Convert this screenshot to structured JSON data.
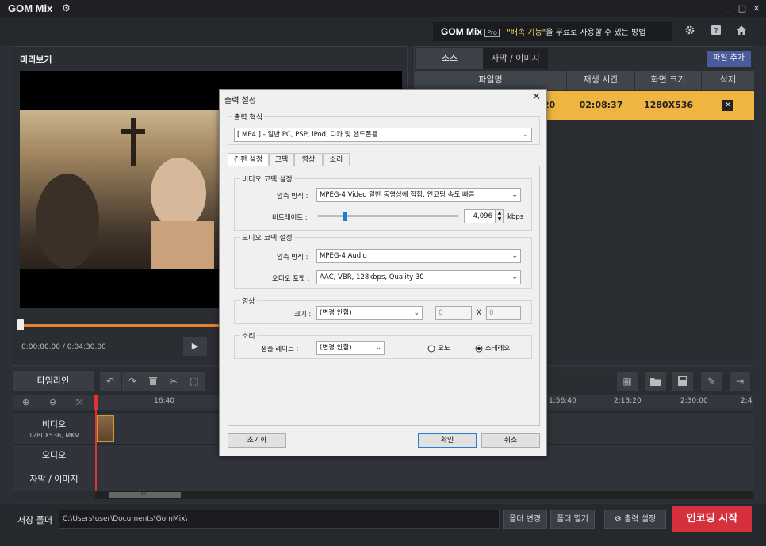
{
  "app": {
    "name": "GOM Mix",
    "gear": "⚙",
    "win_min": "_",
    "win_max": "□",
    "win_close": "✕"
  },
  "promo": {
    "logo": "GOM Mix",
    "tag": "Pro",
    "highlight": "\"배속 기능\"",
    "rest": "을 무료로 사용할 수 있는 방법"
  },
  "preview": {
    "title": "미리보기",
    "time": "0:00:00.00 / 0:04:30.00",
    "play": "▶"
  },
  "source": {
    "tabs": [
      "소스",
      "자막 / 이미지"
    ],
    "add_file": "파일 추가",
    "columns": [
      "파일명",
      "재생 시간",
      "화면 크기",
      "삭제"
    ],
    "rows": [
      {
        "name": ".720",
        "duration": "02:08:37",
        "size": "1280X536",
        "delete": "✕"
      }
    ]
  },
  "timeline": {
    "tab": "타임라인",
    "ruler": [
      "16:40",
      "1:56:40",
      "2:13:20",
      "2:30:00",
      "2:4"
    ],
    "tracks": [
      {
        "name": "비디오",
        "sub": "1280X536, MKV"
      },
      {
        "name": "오디오",
        "sub": ""
      },
      {
        "name": "자막 / 이미지",
        "sub": ""
      }
    ],
    "scroll_mark": "III"
  },
  "bottom": {
    "save_label": "저장 폴더",
    "save_path": "C:\\Users\\user\\Documents\\GomMix\\",
    "btn_change": "폴더 변경",
    "btn_open": "폴더 열기",
    "btn_output": "출력 설정",
    "btn_encode": "인코딩 시작"
  },
  "dialog": {
    "title": "출력 설정",
    "close": "✕",
    "format_label": "출력 형식",
    "format_value": "[ MP4 ] - 일반 PC, PSP, iPod, 디카 및 핸드폰용",
    "tabs": [
      "간편 설정",
      "코덱",
      "영상",
      "소리"
    ],
    "video_codec": {
      "group": "비디오 코덱 설정",
      "method_label": "압축 방식 :",
      "method_value": "MPEG-4 Video 일반 동영상에 적합, 인코딩 속도 빠름",
      "bitrate_label": "비트레이트 :",
      "bitrate_value": "4,096",
      "bitrate_unit": "kbps",
      "bitrate_level": 0.18
    },
    "audio_codec": {
      "group": "오디오 코덱 설정",
      "method_label": "압축 방식 :",
      "method_value": "MPEG-4 Audio",
      "format_label": "오디오 포맷 :",
      "format_value": "AAC, VBR, 128kbps, Quality 30"
    },
    "video": {
      "group": "영상",
      "size_label": "크기 :",
      "size_value": "(변경 안함)",
      "w": "0",
      "x": "X",
      "h": "0"
    },
    "audio": {
      "group": "소리",
      "rate_label": "샘플 레이트 :",
      "rate_value": "(변경 안함)",
      "mono": "모노",
      "stereo": "스테레오",
      "selected": "스테레오"
    },
    "reset": "초기화",
    "ok": "확인",
    "cancel": "취소"
  }
}
